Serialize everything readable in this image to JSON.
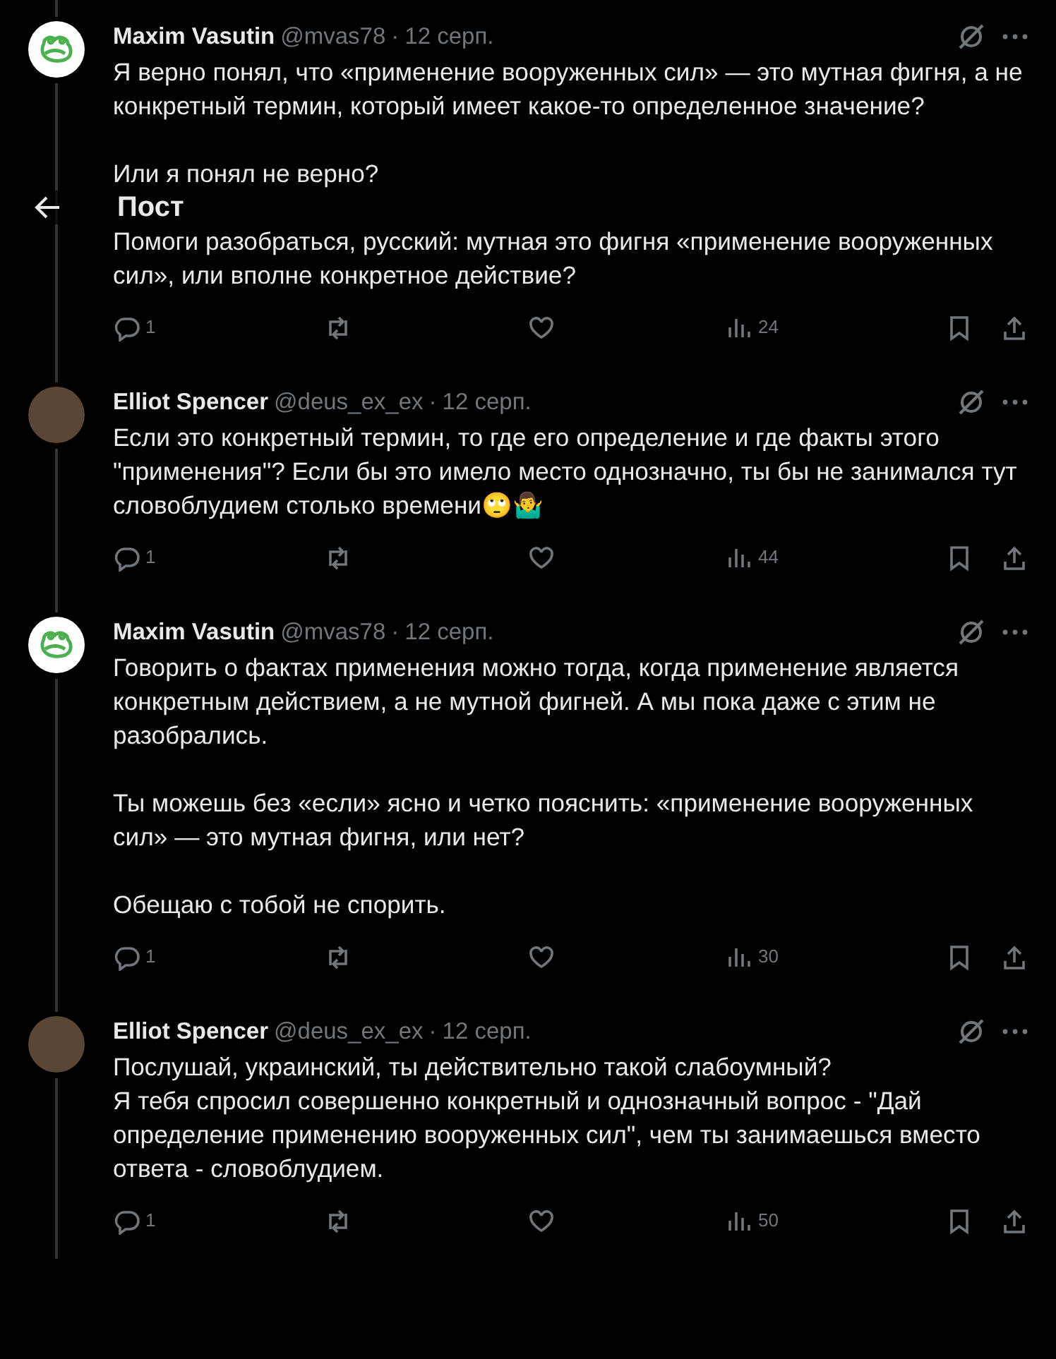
{
  "header": {
    "title": "Пост"
  },
  "tweets": [
    {
      "avatar": {
        "kind": "logo"
      },
      "name": "Maxim Vasutin",
      "handle": "@mvas78",
      "dot": "·",
      "date": "12 серп.",
      "paragraphs": [
        "Я верно понял, что «применение вооруженных сил» — это мутная фигня, а не конкретный термин, который имеет какое-то определенное значение?",
        "Или я понял не верно?",
        "Помоги разобраться, русский: мутная это фигня «применение вооруженных сил», или вполне конкретное действие?"
      ],
      "replies": "1",
      "views": "24"
    },
    {
      "avatar": {
        "kind": "photo"
      },
      "name": "Elliot Spencer",
      "handle": "@deus_ex_ex",
      "dot": "·",
      "date": "12 серп.",
      "paragraphs": [
        "Если это конкретный термин, то где его определение и где факты этого \"применения\"? Если бы это имело место однозначно, ты бы не занимался тут словоблудием столько времени🙄🤷‍♂️"
      ],
      "replies": "1",
      "views": "44"
    },
    {
      "avatar": {
        "kind": "logo"
      },
      "name": "Maxim Vasutin",
      "handle": "@mvas78",
      "dot": "·",
      "date": "12 серп.",
      "paragraphs": [
        "Говорить о фактах применения можно тогда, когда применение является конкретным действием, а не мутной фигней. А мы пока даже с этим не разобрались.",
        "Ты можешь без «если» ясно и четко пояснить: «применение вооруженных сил» — это мутная фигня, или нет?",
        "Обещаю с тобой не спорить."
      ],
      "replies": "1",
      "views": "30"
    },
    {
      "avatar": {
        "kind": "photo"
      },
      "name": "Elliot Spencer",
      "handle": "@deus_ex_ex",
      "dot": "·",
      "date": "12 серп.",
      "paragraphs": [
        "Послушай, украинский, ты действительно такой слабоумный?\nЯ тебя спросил совершенно конкретный и однозначный вопрос - \"Дай определение применению вооруженных сил\", чем ты занимаешься вместо ответа - словоблудием."
      ],
      "replies": "1",
      "views": "50"
    }
  ]
}
